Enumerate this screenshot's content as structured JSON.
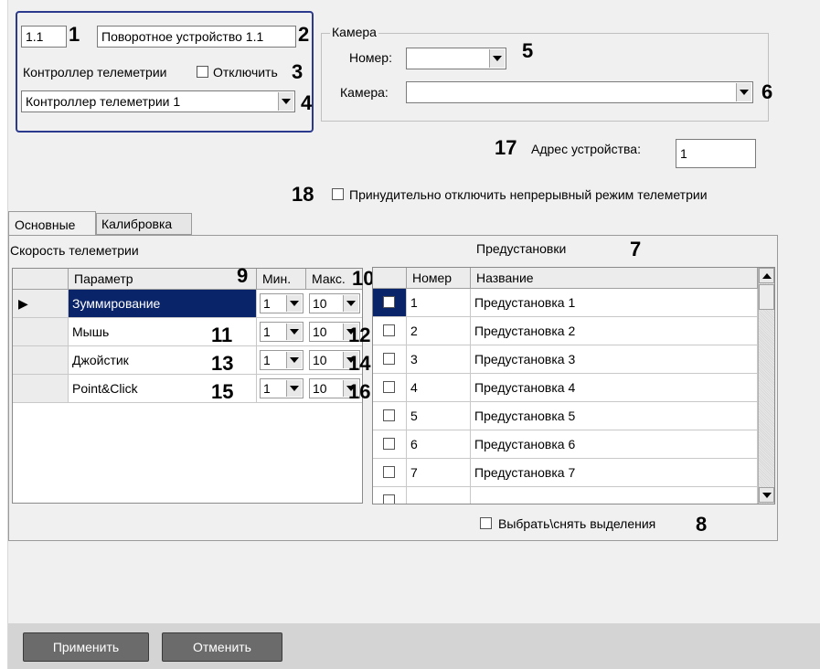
{
  "device": {
    "id": "1.1",
    "name": "Поворотное устройство 1.1",
    "controller_label": "Контроллер телеметрии",
    "disable_label": "Отключить",
    "controller_value": "Контроллер телеметрии 1"
  },
  "camera_group": {
    "title": "Камера",
    "number_label": "Номер:",
    "number_value": "",
    "camera_label": "Камера:",
    "camera_value": ""
  },
  "address": {
    "label": "Адрес устройства:",
    "value": "1"
  },
  "force_disable_label": "Принудительно отключить непрерывный режим телеметрии",
  "tabs": [
    {
      "label": "Основные",
      "active": true
    },
    {
      "label": "Калибровка",
      "active": false
    }
  ],
  "speed": {
    "title": "Скорость телеметрии",
    "headers": {
      "param": "Параметр",
      "min": "Мин.",
      "max": "Макс."
    },
    "rows": [
      {
        "param": "Зуммирование",
        "min": "1",
        "max": "10",
        "selected": true
      },
      {
        "param": "Мышь",
        "min": "1",
        "max": "10",
        "selected": false
      },
      {
        "param": "Джойстик",
        "min": "1",
        "max": "10",
        "selected": false
      },
      {
        "param": "Point&Click",
        "min": "1",
        "max": "10",
        "selected": false
      }
    ]
  },
  "presets": {
    "title": "Предустановки",
    "headers": {
      "number": "Номер",
      "name": "Название"
    },
    "rows": [
      {
        "number": "1",
        "name": "Предустановка 1"
      },
      {
        "number": "2",
        "name": "Предустановка 2"
      },
      {
        "number": "3",
        "name": "Предустановка 3"
      },
      {
        "number": "4",
        "name": "Предустановка 4"
      },
      {
        "number": "5",
        "name": "Предустановка 5"
      },
      {
        "number": "6",
        "name": "Предустановка 6"
      },
      {
        "number": "7",
        "name": "Предустановка 7"
      }
    ],
    "select_all_label": "Выбрать\\снять выделения"
  },
  "callouts": [
    "1",
    "2",
    "3",
    "4",
    "5",
    "6",
    "7",
    "8",
    "9",
    "10",
    "11",
    "12",
    "13",
    "14",
    "15",
    "16",
    "17",
    "18"
  ],
  "buttons": {
    "apply": "Применить",
    "cancel": "Отменить"
  },
  "colors": {
    "selection": "#0a246a",
    "accent_border": "#2b3a8c",
    "button": "#6b6b6b"
  }
}
